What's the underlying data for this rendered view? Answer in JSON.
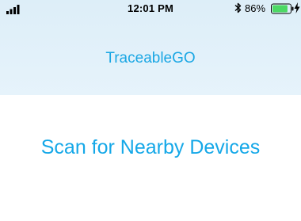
{
  "status_bar": {
    "time": "12:01 PM",
    "battery_percent": "86%",
    "battery_level": 0.86,
    "icons": [
      "signal-icon",
      "bluetooth-icon",
      "battery-icon",
      "charging-icon"
    ]
  },
  "header": {
    "title": "TraceableGO"
  },
  "main": {
    "scan_label": "Scan for Nearby Devices"
  },
  "colors": {
    "accent": "#15a8e8",
    "header_bg": "#e2f1fa",
    "battery_fill": "#4cd964"
  }
}
